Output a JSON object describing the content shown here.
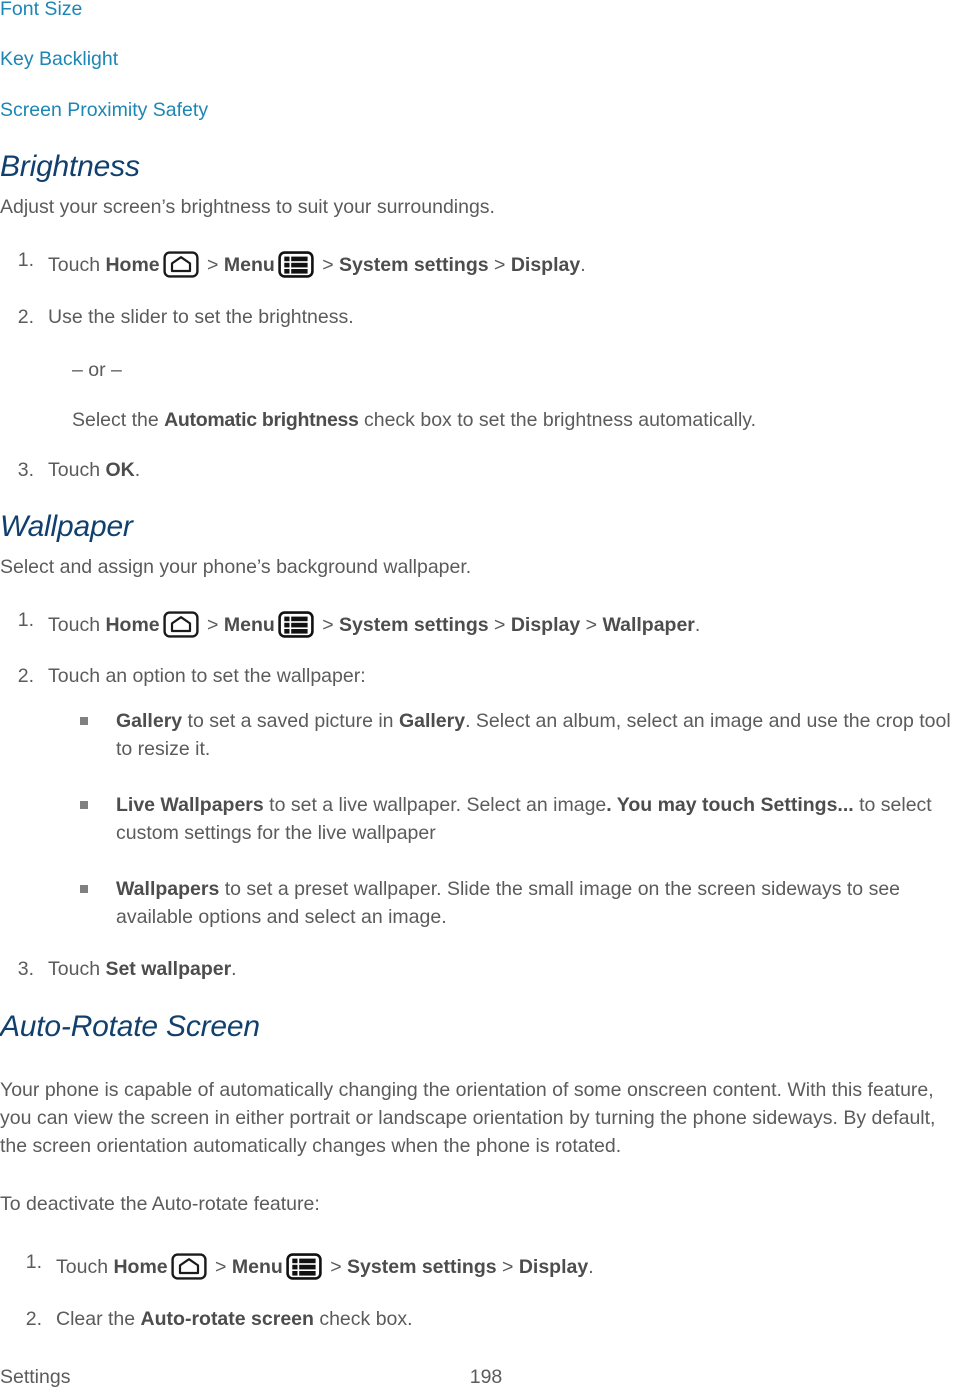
{
  "document": {
    "toc_links": [
      {
        "label": "Font Size"
      },
      {
        "label": "Key Backlight"
      },
      {
        "label": "Screen Proximity Safety"
      }
    ],
    "link_color": "#1c86b4",
    "heading_color": "#12406e",
    "body_color": "#5b5b5b"
  },
  "sections": {
    "brightness": {
      "heading": "Brightness",
      "intro": "Adjust your screen’s brightness to suit your surroundings.",
      "steps": [
        {
          "number": "1.",
          "prefix": "Touch ",
          "bold1": "Home",
          "icon1": "home-icon",
          "sep1": " > ",
          "bold2": "Menu",
          "icon2": "menu-icon",
          "sep2": " > ",
          "bold3": "System settings",
          "sep3": " > ",
          "bold4": "Display",
          "suffix": "."
        },
        {
          "number": "2.",
          "text": "Use the slider to set the brightness."
        },
        {
          "number": "3.",
          "prefix": "Touch ",
          "bold1": "OK",
          "suffix": "."
        }
      ],
      "or_divider": "– or –",
      "alt_step": {
        "prefix": "Select the ",
        "emphasis": "Automatic brightness",
        "suffix": " check box to set the brightness automatically."
      }
    },
    "wallpaper": {
      "heading": "Wallpaper",
      "intro": "Select and assign your phone’s background wallpaper.",
      "step1": {
        "number": "1.",
        "prefix": "Touch ",
        "bold1": "Home",
        "icon1": "home-icon",
        "sep1": " > ",
        "bold2": "Menu",
        "icon2": "menu-icon",
        "sep2": " > ",
        "bold3": "System settings",
        "sep3": " > ",
        "bold4": "Display",
        "sep4": " > ",
        "bold5": "Wallpaper",
        "suffix": "."
      },
      "step2": {
        "number": "2.",
        "text": "Touch an option to set the wallpaper:"
      },
      "bullets": [
        {
          "bold1": "Gallery",
          "mid1": " to set a saved picture in ",
          "bold2": "Gallery",
          "rest": ". Select an album, select an image and use the crop tool to resize it."
        },
        {
          "bold1": "Live Wallpapers",
          "mid1": " to set a live wallpaper. Select an image",
          "bold2": ". You may touch Settings...",
          "rest": " to select custom settings for the live wallpaper"
        },
        {
          "bold1": "Wallpapers",
          "mid1": " to set a preset wallpaper. Slide the small image on the screen sideways to see available options and select an image.",
          "bold2": "",
          "rest": ""
        }
      ],
      "step3": {
        "number": "3.",
        "prefix": "Touch ",
        "bold1": "Set wallpaper",
        "suffix": "."
      }
    },
    "auto_rotate": {
      "heading": "Auto-Rotate Screen",
      "intro": "Your phone is capable of automatically changing the orientation of some onscreen content. With this feature, you can view the screen in either portrait or landscape orientation by turning the phone sideways. By default, the screen orientation automatically changes when the phone is rotated.",
      "lead_in": "To deactivate the Auto-rotate feature:",
      "step1": {
        "number": "1.",
        "prefix": "Touch ",
        "bold1": "Home",
        "icon1": "home-icon",
        "sep1": " > ",
        "bold2": "Menu",
        "icon2": "menu-icon",
        "sep2": " > ",
        "bold3": "System settings",
        "sep3": " > ",
        "bold4": "Display",
        "suffix": "."
      },
      "step2": {
        "number": "2.",
        "prefix": "Clear the ",
        "bold1": "Auto-rotate screen",
        "suffix": " check box."
      }
    }
  },
  "footer": {
    "section_label": "Settings",
    "page_number": "198"
  }
}
